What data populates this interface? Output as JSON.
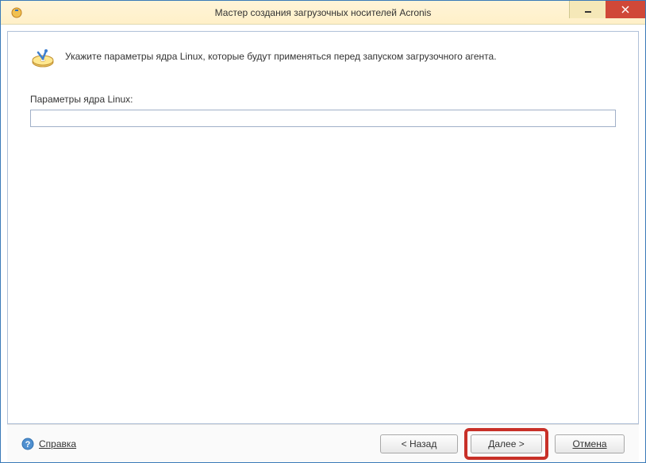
{
  "titlebar": {
    "title": "Мастер создания загрузочных носителей Acronis"
  },
  "header": {
    "instruction": "Укажите параметры ядра Linux, которые будут применяться перед запуском загрузочного агента."
  },
  "form": {
    "label": "Параметры ядра Linux:",
    "value": ""
  },
  "footer": {
    "help": "Справка",
    "back": "< Назад",
    "next": "Далее >",
    "cancel": "Отмена"
  }
}
